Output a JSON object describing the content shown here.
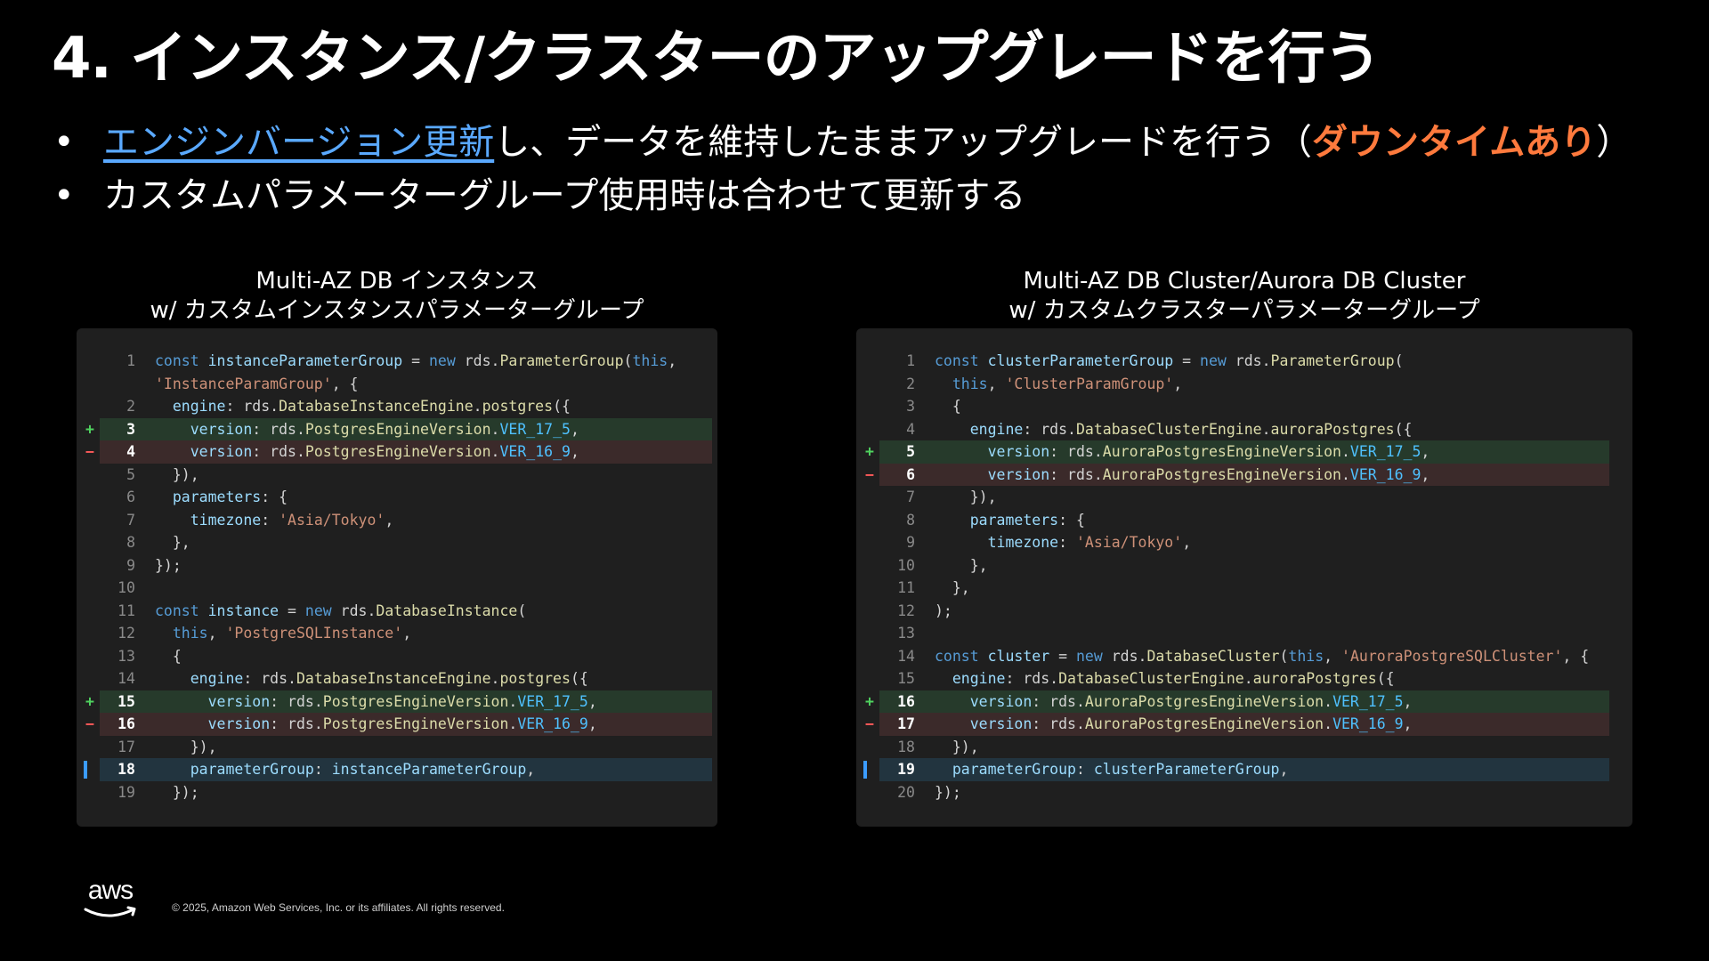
{
  "title": "4. インスタンス/クラスターのアップグレードを行う",
  "bullets": [
    {
      "link_text": "エンジンバージョン更新",
      "text": "し、データを維持したままアップグレードを行う（",
      "accent": "ダウンタイムあり",
      "suffix": "）"
    },
    {
      "text": "カスタムパラメーターグループ使用時は合わせて更新する"
    }
  ],
  "colors": {
    "link": "#5aa9ff",
    "accent": "#ff7a3d",
    "added_marker": "#4fd35f",
    "removed_marker": "#ff5a5a",
    "current_marker": "#3b9cff"
  },
  "left_panel": {
    "caption_line1": "Multi-AZ DB インスタンス",
    "caption_line2": "w/ カスタムインスタンスパラメーターグループ",
    "lines": [
      {
        "n": "1",
        "code": "const instanceParameterGroup = new rds.ParameterGroup(this,",
        "type": "normal"
      },
      {
        "n": "",
        "code": "'InstanceParamGroup', {",
        "type": "normal"
      },
      {
        "n": "2",
        "code": "  engine: rds.DatabaseInstanceEngine.postgres({",
        "type": "normal"
      },
      {
        "n": "3",
        "code": "    version: rds.PostgresEngineVersion.VER_17_5,",
        "type": "added"
      },
      {
        "n": "4",
        "code": "    version: rds.PostgresEngineVersion.VER_16_9,",
        "type": "removed"
      },
      {
        "n": "5",
        "code": "  }),",
        "type": "normal"
      },
      {
        "n": "6",
        "code": "  parameters: {",
        "type": "normal"
      },
      {
        "n": "7",
        "code": "    timezone: 'Asia/Tokyo',",
        "type": "normal"
      },
      {
        "n": "8",
        "code": "  },",
        "type": "normal"
      },
      {
        "n": "9",
        "code": "});",
        "type": "normal"
      },
      {
        "n": "10",
        "code": "",
        "type": "normal"
      },
      {
        "n": "11",
        "code": "const instance = new rds.DatabaseInstance(",
        "type": "normal"
      },
      {
        "n": "12",
        "code": "  this, 'PostgreSQLInstance',",
        "type": "normal"
      },
      {
        "n": "13",
        "code": "  {",
        "type": "normal"
      },
      {
        "n": "14",
        "code": "    engine: rds.DatabaseInstanceEngine.postgres({",
        "type": "normal"
      },
      {
        "n": "15",
        "code": "      version: rds.PostgresEngineVersion.VER_17_5,",
        "type": "added"
      },
      {
        "n": "16",
        "code": "      version: rds.PostgresEngineVersion.VER_16_9,",
        "type": "removed"
      },
      {
        "n": "17",
        "code": "    }),",
        "type": "normal"
      },
      {
        "n": "18",
        "code": "    parameterGroup: instanceParameterGroup,",
        "type": "current"
      },
      {
        "n": "19",
        "code": "  });",
        "type": "normal"
      }
    ]
  },
  "right_panel": {
    "caption_line1": "Multi-AZ DB Cluster/Aurora DB Cluster",
    "caption_line2": "w/ カスタムクラスターパラメーターグループ",
    "lines": [
      {
        "n": "1",
        "code": "const clusterParameterGroup = new rds.ParameterGroup(",
        "type": "normal"
      },
      {
        "n": "2",
        "code": "  this, 'ClusterParamGroup',",
        "type": "normal"
      },
      {
        "n": "3",
        "code": "  {",
        "type": "normal"
      },
      {
        "n": "4",
        "code": "    engine: rds.DatabaseClusterEngine.auroraPostgres({",
        "type": "normal"
      },
      {
        "n": "5",
        "code": "      version: rds.AuroraPostgresEngineVersion.VER_17_5,",
        "type": "added"
      },
      {
        "n": "6",
        "code": "      version: rds.AuroraPostgresEngineVersion.VER_16_9,",
        "type": "removed"
      },
      {
        "n": "7",
        "code": "    }),",
        "type": "normal"
      },
      {
        "n": "8",
        "code": "    parameters: {",
        "type": "normal"
      },
      {
        "n": "9",
        "code": "      timezone: 'Asia/Tokyo',",
        "type": "normal"
      },
      {
        "n": "10",
        "code": "    },",
        "type": "normal"
      },
      {
        "n": "11",
        "code": "  },",
        "type": "normal"
      },
      {
        "n": "12",
        "code": ");",
        "type": "normal"
      },
      {
        "n": "13",
        "code": "",
        "type": "normal"
      },
      {
        "n": "14",
        "code": "const cluster = new rds.DatabaseCluster(this, 'AuroraPostgreSQLCluster', {",
        "type": "normal"
      },
      {
        "n": "15",
        "code": "  engine: rds.DatabaseClusterEngine.auroraPostgres({",
        "type": "normal"
      },
      {
        "n": "16",
        "code": "    version: rds.AuroraPostgresEngineVersion.VER_17_5,",
        "type": "added"
      },
      {
        "n": "17",
        "code": "    version: rds.AuroraPostgresEngineVersion.VER_16_9,",
        "type": "removed"
      },
      {
        "n": "18",
        "code": "  }),",
        "type": "normal"
      },
      {
        "n": "19",
        "code": "  parameterGroup: clusterParameterGroup,",
        "type": "current"
      },
      {
        "n": "20",
        "code": "});",
        "type": "normal"
      }
    ]
  },
  "footer": {
    "logo": "aws",
    "copyright": "© 2025, Amazon Web Services, Inc. or its affiliates. All rights reserved."
  }
}
